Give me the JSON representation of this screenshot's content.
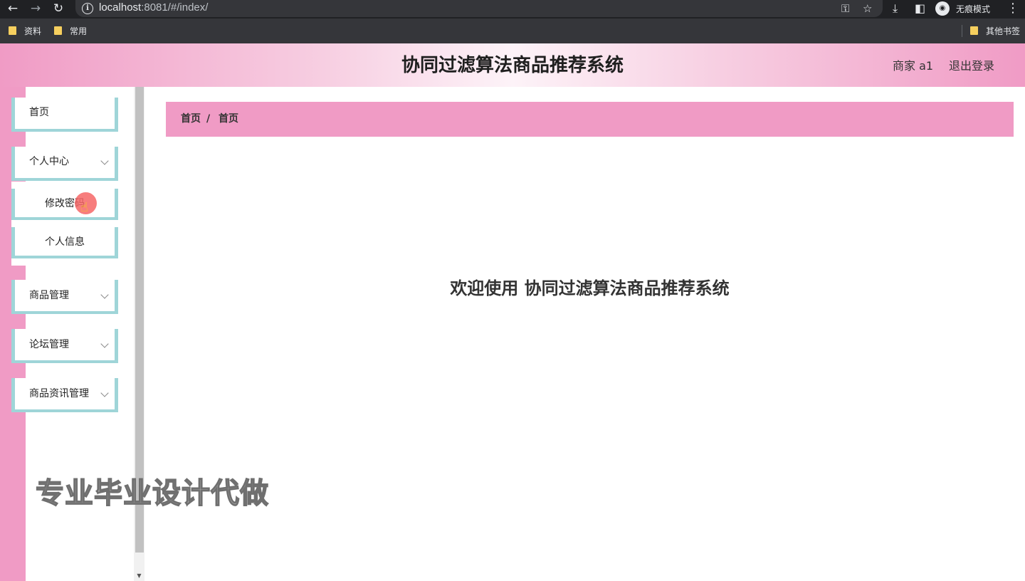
{
  "browser": {
    "url_host": "localhost",
    "url_rest": ":8081/#/index/",
    "incognito_label": "无痕模式",
    "bookmarks": [
      "资料",
      "常用"
    ],
    "other_bookmarks": "其他书签"
  },
  "header": {
    "title": "协同过滤算法商品推荐系统",
    "user": "商家 a1",
    "logout": "退出登录"
  },
  "sidebar": {
    "items": [
      {
        "label": "首页"
      },
      {
        "label": "个人中心",
        "expanded": true,
        "children": [
          {
            "label": "修改密码"
          },
          {
            "label": "个人信息"
          }
        ]
      },
      {
        "label": "商品管理"
      },
      {
        "label": "论坛管理"
      },
      {
        "label": "商品资讯管理"
      }
    ]
  },
  "breadcrumb": [
    "首页",
    "首页"
  ],
  "main": {
    "welcome": "欢迎使用 协同过滤算法商品推荐系统"
  },
  "watermark": "专业毕业设计代做",
  "colors": {
    "accent_pink": "#f09bc5",
    "menu_border_teal": "#9fd5d8"
  }
}
